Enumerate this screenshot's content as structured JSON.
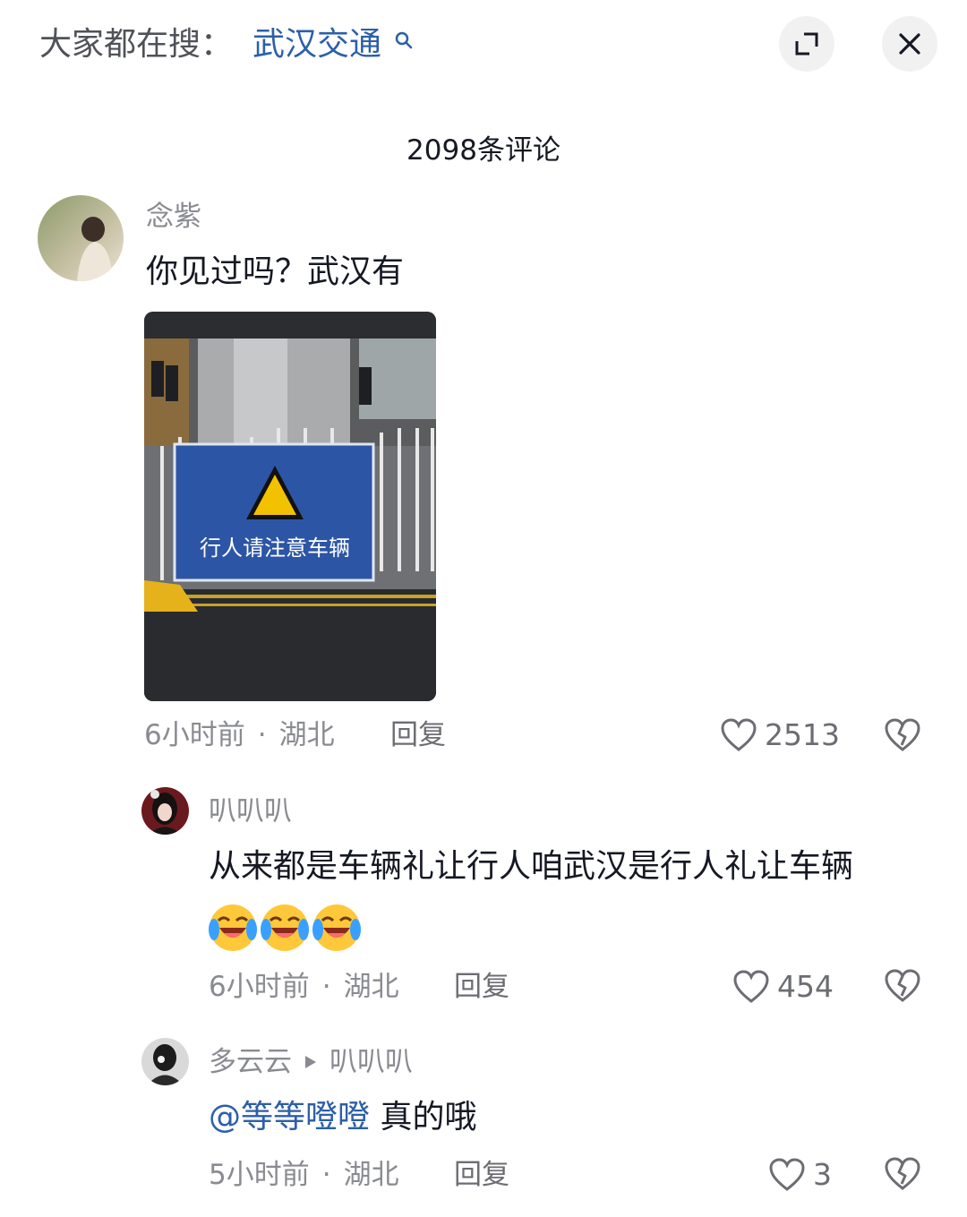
{
  "topbar": {
    "prefix": "大家都在搜：",
    "term": "武汉交通",
    "search_icon": "search-icon",
    "expand_icon": "expand-icon",
    "close_icon": "close-icon"
  },
  "comments_header": {
    "count_text": "2098条评论"
  },
  "comments": [
    {
      "username": "念紫",
      "text": "你见过吗？武汉有",
      "image": {
        "sign_text": "行人请注意车辆"
      },
      "time": "6小时前",
      "sep": "·",
      "location": "湖北",
      "reply": "回复",
      "likes": "2513"
    },
    {
      "username": "叭叭叭",
      "text": "从来都是车辆礼让行人咱武汉是行人礼让车辆",
      "emojis": [
        "laugh-cry-emoji",
        "laugh-cry-emoji",
        "laugh-cry-emoji"
      ],
      "time": "6小时前",
      "sep": "·",
      "location": "湖北",
      "reply": "回复",
      "likes": "454"
    },
    {
      "username": "多云云",
      "reply_to": "叭叭叭",
      "mention": "@等等噔噔",
      "text": " 真的哦",
      "time": "5小时前",
      "sep": "·",
      "location": "湖北",
      "reply": "回复",
      "likes": "3"
    }
  ],
  "colors": {
    "accent": "#2c5fa8",
    "meta": "#8a8b91",
    "text": "#161823",
    "sign_blue": "#2d55a5"
  }
}
